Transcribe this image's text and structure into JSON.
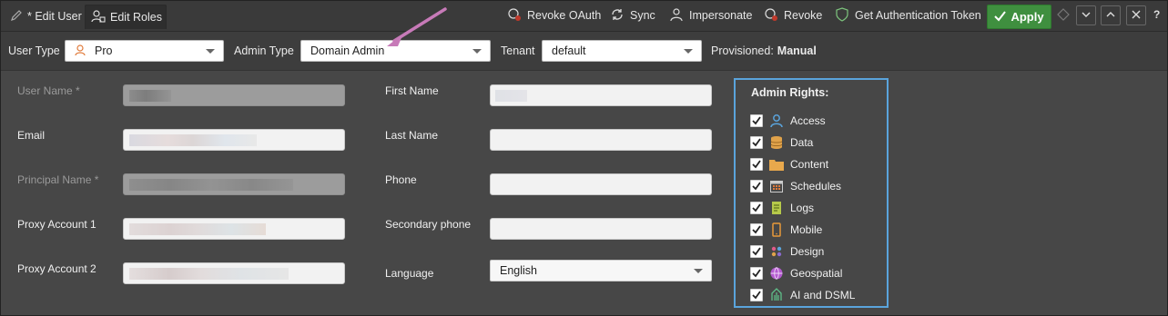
{
  "tabs": [
    {
      "label": "* Edit User",
      "icon": "pencil-icon"
    },
    {
      "label": "Edit Roles",
      "icon": "roles-icon"
    }
  ],
  "toolbar": {
    "revoke_oauth": "Revoke OAuth",
    "sync": "Sync",
    "impersonate": "Impersonate",
    "revoke": "Revoke",
    "get_token": "Get Authentication Token",
    "apply": "Apply",
    "help": "?"
  },
  "filters": {
    "user_type_label": "User Type",
    "user_type_value": "Pro",
    "admin_type_label": "Admin Type",
    "admin_type_value": "Domain Admin",
    "tenant_label": "Tenant",
    "tenant_value": "default",
    "provisioned_label": "Provisioned:",
    "provisioned_value": "Manual"
  },
  "form": {
    "user_name_label": "User Name *",
    "email_label": "Email",
    "principal_name_label": "Principal Name *",
    "proxy1_label": "Proxy Account 1",
    "proxy2_label": "Proxy Account 2",
    "first_name_label": "First Name",
    "last_name_label": "Last Name",
    "phone_label": "Phone",
    "secondary_phone_label": "Secondary phone",
    "language_label": "Language",
    "language_value": "English"
  },
  "admin_rights": {
    "title": "Admin Rights:",
    "items": [
      {
        "label": "Access",
        "checked": true,
        "icon": "person-icon"
      },
      {
        "label": "Data",
        "checked": true,
        "icon": "database-icon"
      },
      {
        "label": "Content",
        "checked": true,
        "icon": "folder-icon"
      },
      {
        "label": "Schedules",
        "checked": true,
        "icon": "calendar-icon"
      },
      {
        "label": "Logs",
        "checked": true,
        "icon": "log-icon"
      },
      {
        "label": "Mobile",
        "checked": true,
        "icon": "mobile-icon"
      },
      {
        "label": "Design",
        "checked": true,
        "icon": "palette-icon"
      },
      {
        "label": "Geospatial",
        "checked": true,
        "icon": "globe-icon"
      },
      {
        "label": "AI and DSML",
        "checked": true,
        "icon": "ai-icon"
      }
    ]
  },
  "colors": {
    "accent_border": "#5aa4dc",
    "apply_green": "#3f8f3f",
    "annotation_arrow": "#c77ab8"
  }
}
